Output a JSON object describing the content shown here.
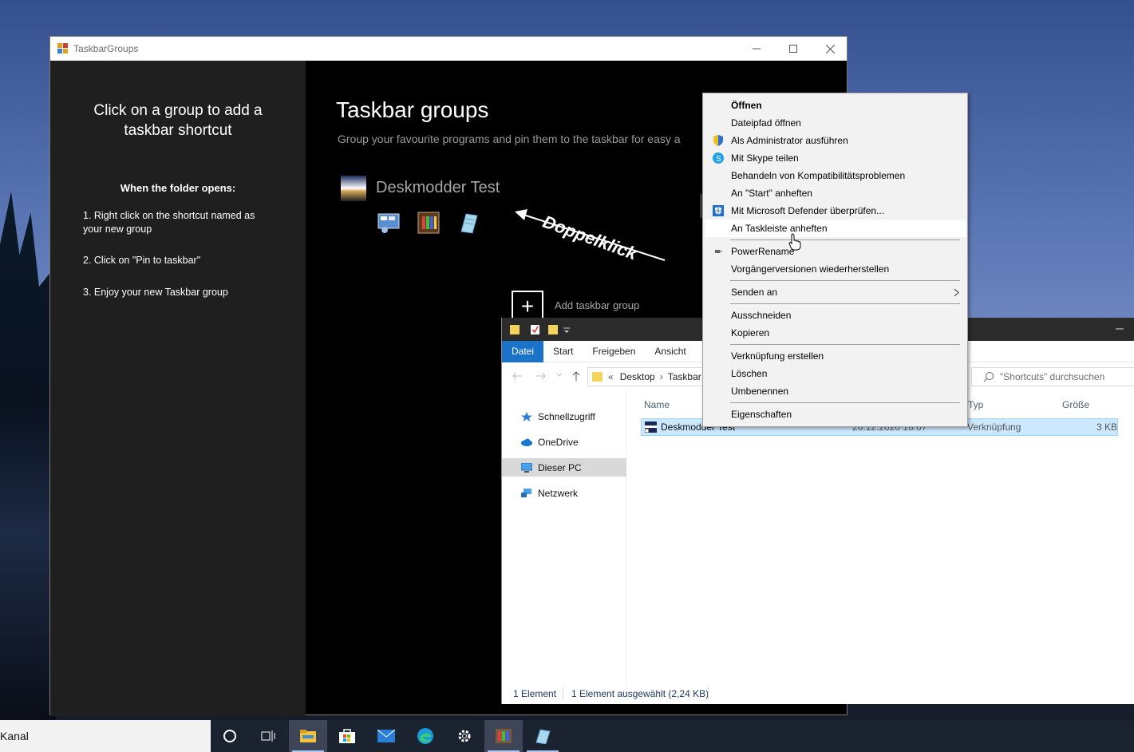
{
  "taskbar_groups_window": {
    "title": "TaskbarGroups",
    "left_panel": {
      "heading": "Click on a group to add a taskbar shortcut",
      "subheading": "When the folder opens:",
      "steps": [
        "1. Right click on the shortcut named as your new group",
        "2. Click on \"Pin to taskbar\"",
        "3. Enjoy your new Taskbar group"
      ]
    },
    "main": {
      "title": "Taskbar groups",
      "subtitle": "Group your favourite programs and pin them to the taskbar for easy a",
      "group_name": "Deskmodder Test",
      "annotation": "Doppelklick",
      "add_label": "Add taskbar group"
    }
  },
  "explorer": {
    "ribbon_tabs": [
      "Datei",
      "Start",
      "Freigeben",
      "Ansicht"
    ],
    "breadcrumb": [
      "«",
      "Desktop",
      "›",
      "Taskbar"
    ],
    "search_placeholder": "\"Shortcuts\" durchsuchen",
    "nav": [
      "Schnellzugriff",
      "OneDrive",
      "Dieser PC",
      "Netzwerk"
    ],
    "columns": {
      "name": "Name",
      "type": "Typ",
      "size": "Größe"
    },
    "row": {
      "name": "Deskmodder Test",
      "date": "26.12.2020 18:07",
      "type": "Verknüpfung",
      "size": "3 KB"
    },
    "status": {
      "count": "1 Element",
      "selected": "1 Element ausgewählt (2,24 KB)"
    }
  },
  "context_menu": {
    "items": [
      "Öffnen",
      "Dateipfad öffnen",
      "Als Administrator ausführen",
      "Mit Skype teilen",
      "Behandeln von Kompatibilitätsproblemen",
      "An \"Start\" anheften",
      "Mit Microsoft Defender überprüfen...",
      "An Taskleiste anheften",
      "PowerRename",
      "Vorgängerversionen wiederherstellen",
      "Senden an",
      "Ausschneiden",
      "Kopieren",
      "Verknüpfung erstellen",
      "Löschen",
      "Umbenennen",
      "Eigenschaften"
    ]
  },
  "taskbar": {
    "search_text": "Kanal"
  },
  "colors": {
    "ribbon_active": "#1a73c9",
    "selection": "#cce8ff",
    "taskbar_bg": "#1b2230"
  }
}
